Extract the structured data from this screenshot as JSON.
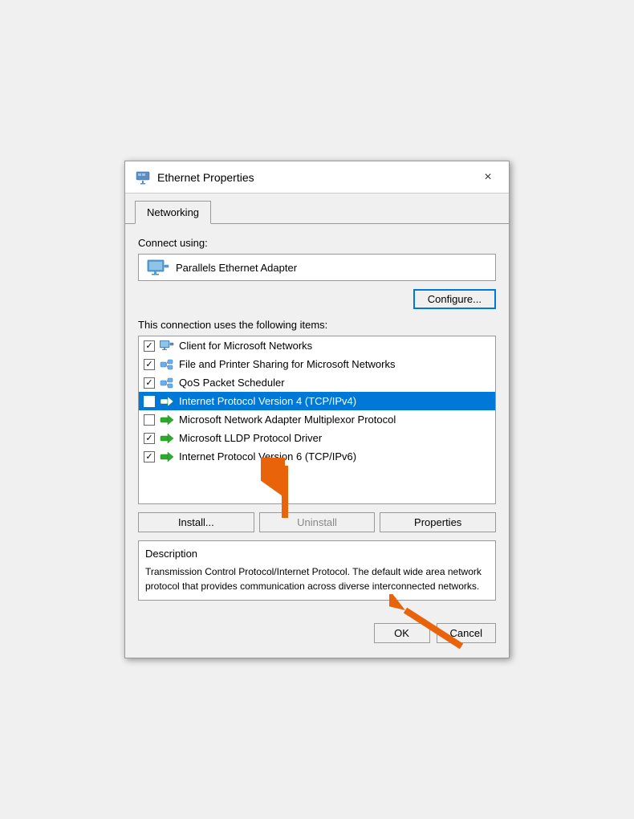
{
  "titleBar": {
    "title": "Ethernet Properties",
    "closeLabel": "×"
  },
  "tabs": [
    {
      "label": "Networking",
      "active": true
    }
  ],
  "connectUsing": {
    "label": "Connect using:",
    "adapterName": "Parallels Ethernet Adapter"
  },
  "configureButton": "Configure...",
  "connectionItemsLabel": "This connection uses the following items:",
  "items": [
    {
      "checked": true,
      "iconType": "network",
      "label": "Client for Microsoft Networks",
      "selected": false
    },
    {
      "checked": true,
      "iconType": "share",
      "label": "File and Printer Sharing for Microsoft Networks",
      "selected": false
    },
    {
      "checked": true,
      "iconType": "share",
      "label": "QoS Packet Scheduler",
      "selected": false
    },
    {
      "checked": true,
      "iconType": "green",
      "label": "Internet Protocol Version 4 (TCP/IPv4)",
      "selected": true
    },
    {
      "checked": false,
      "iconType": "green",
      "label": "Microsoft Network Adapter Multiplexor Protocol",
      "selected": false
    },
    {
      "checked": true,
      "iconType": "green",
      "label": "Microsoft LLDP Protocol Driver",
      "selected": false
    },
    {
      "checked": true,
      "iconType": "green",
      "label": "Internet Protocol Version 6 (TCP/IPv6)",
      "selected": false
    }
  ],
  "buttons": {
    "install": "Install...",
    "uninstall": "Uninstall",
    "properties": "Properties"
  },
  "description": {
    "title": "Description",
    "text": "Transmission Control Protocol/Internet Protocol. The default wide area network protocol that provides communication across diverse interconnected networks."
  },
  "okCancel": {
    "ok": "OK",
    "cancel": "Cancel"
  }
}
